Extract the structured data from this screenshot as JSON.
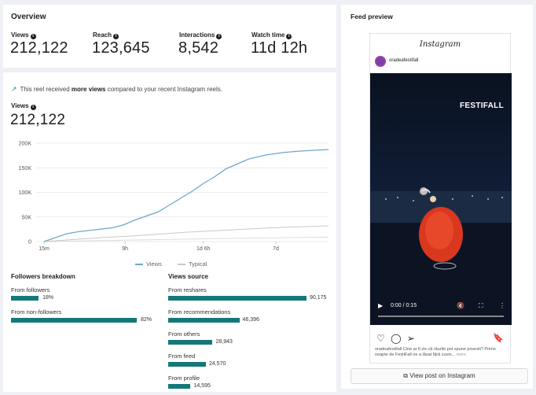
{
  "overview": {
    "title": "Overview",
    "metrics": [
      {
        "label": "Views",
        "value": "212,122"
      },
      {
        "label": "Reach",
        "value": "123,645"
      },
      {
        "label": "Interactions",
        "value": "8,542"
      },
      {
        "label": "Watch time",
        "value": "11d 12h"
      }
    ]
  },
  "main": {
    "banner_prefix": "This reel received ",
    "banner_bold": "more views",
    "banner_suffix": " compared to your recent Instagram reels.",
    "views_label": "Views",
    "views_value": "212,122",
    "legend": [
      {
        "label": "Views",
        "color": "#6fa8c8"
      },
      {
        "label": "Typical",
        "color": "#c8c8c8"
      }
    ]
  },
  "chart_data": {
    "type": "line",
    "x_ticks": [
      "15m",
      "9h",
      "1d 6h",
      "7d"
    ],
    "y_ticks": [
      "0",
      "50K",
      "100K",
      "150K",
      "200K"
    ],
    "ylim": [
      0,
      200000
    ],
    "series": [
      {
        "name": "Views",
        "color": "#6fa8c8",
        "x": [
          0,
          0.04,
          0.08,
          0.12,
          0.18,
          0.24,
          0.28,
          0.32,
          0.36,
          0.4,
          0.44,
          0.48,
          0.52,
          0.56,
          0.6,
          0.64,
          0.68,
          0.72,
          0.78,
          0.84,
          0.9,
          0.96,
          1.0
        ],
        "values": [
          0,
          8000,
          16000,
          20000,
          24000,
          28000,
          34000,
          44000,
          52000,
          60000,
          74000,
          88000,
          102000,
          118000,
          132000,
          148000,
          158000,
          168000,
          176000,
          181000,
          184000,
          186000,
          187000
        ]
      },
      {
        "name": "Typical",
        "color": "#c8c8c8",
        "x": [
          0,
          0.1,
          0.2,
          0.3,
          0.4,
          0.5,
          0.6,
          0.7,
          0.8,
          0.9,
          1.0
        ],
        "values": [
          0,
          4000,
          8000,
          11000,
          15000,
          19000,
          22000,
          25000,
          28000,
          30000,
          32000
        ]
      },
      {
        "name": "",
        "color": "#dcdcdc",
        "x": [
          0,
          0.2,
          0.4,
          0.6,
          0.8,
          1.0
        ],
        "values": [
          0,
          2000,
          4000,
          6000,
          7500,
          9000
        ]
      }
    ]
  },
  "followers": {
    "title": "Followers breakdown",
    "rows": [
      {
        "label": "From followers",
        "value": "18%",
        "fraction": 0.18
      },
      {
        "label": "From non-followers",
        "value": "82%",
        "fraction": 0.82
      }
    ]
  },
  "sources": {
    "title": "Views source",
    "rows": [
      {
        "label": "From reshares",
        "value": "90,175",
        "amount": 90175
      },
      {
        "label": "From recommendations",
        "value": "46,396",
        "amount": 46396
      },
      {
        "label": "From others",
        "value": "28,943",
        "amount": 28943
      },
      {
        "label": "From feed",
        "value": "24,570",
        "amount": 24570
      },
      {
        "label": "From profile",
        "value": "14,595",
        "amount": 14595
      }
    ]
  },
  "preview": {
    "title": "Feed preview",
    "logo": "Instagram",
    "username": "oradeafestifall",
    "video_title": "FESTIFALL",
    "time": "0:00 / 0:15",
    "caption": "oradeafestifall Cine ar fi zis că râurile pot spune povesti? Primo noapte de FestiFall ne a lăsat fără cuvin...",
    "caption_more": "more",
    "button": "View post on Instagram"
  }
}
